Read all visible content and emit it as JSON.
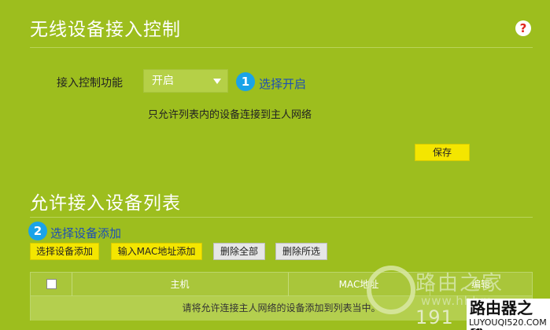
{
  "section1": {
    "title": "无线设备接入控制",
    "help_icon": "help-question-icon",
    "field_label": "接入控制功能",
    "select_value": "开启",
    "hint_number": "1",
    "hint_text": "选择开启",
    "description": "只允许列表内的设备连接到主人网络",
    "save_label": "保存"
  },
  "section2": {
    "title": "允许接入设备列表",
    "hint_number": "2",
    "hint_text": "选择设备添加",
    "buttons": {
      "select_device": "选择设备添加",
      "input_mac": "输入MAC地址添加",
      "delete_all": "删除全部",
      "delete_selected": "删除所选"
    },
    "table": {
      "headers": [
        "主机",
        "MAC地址",
        "编辑"
      ],
      "empty_message": "请将允许连接主人网络的设备添加到列表当中。"
    }
  },
  "watermark": {
    "brand_cn": "路由之家",
    "url": "www.hhhm",
    "number": "191",
    "logo_cn": "路由器之家",
    "logo_url": "LUYOUQI520.COM"
  },
  "colors": {
    "background": "#9dbe1e",
    "accent_blue": "#1aa3e8",
    "button_yellow": "#f4e600",
    "help_red": "#e1261c"
  }
}
